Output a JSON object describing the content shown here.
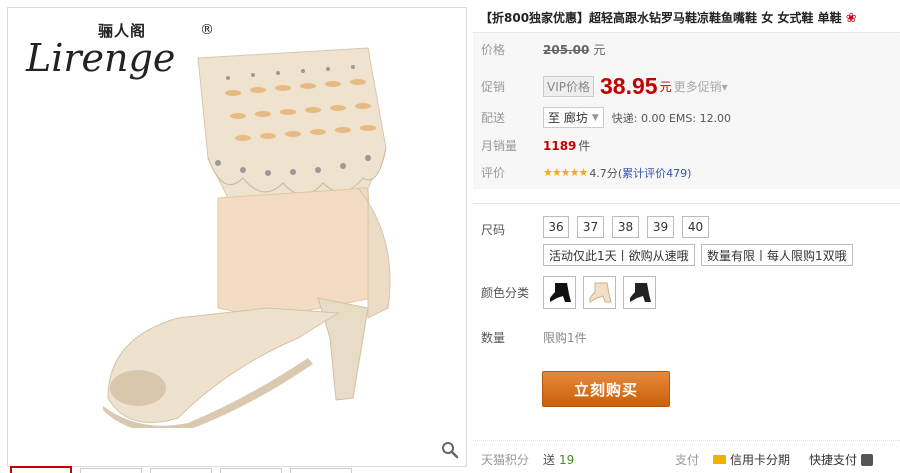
{
  "brand": {
    "cn": "骊人阁",
    "name": "Lirenge",
    "reg": "®"
  },
  "product": {
    "title": "【折800独家优惠】超轻高跟水钻罗马鞋凉鞋鱼嘴鞋 女 女式鞋 单鞋",
    "flower": "❀"
  },
  "price": {
    "label": "价格",
    "original": "205.00",
    "yuan": "元"
  },
  "promo": {
    "label": "促销",
    "vip": "VIP价格",
    "price": "38.95",
    "yuan": "元",
    "more": "更多促销▾"
  },
  "delivery": {
    "label": "配送",
    "region": "至 廊坊",
    "shipping": "快递: 0.00 EMS: 12.00"
  },
  "sales": {
    "label": "月销量",
    "count": "1189",
    "unit": "件"
  },
  "rating": {
    "label": "评价",
    "stars": "★★★★★",
    "score": "4.7分",
    "reviews": "(累计评价479)"
  },
  "options": {
    "size_label": "尺码",
    "sizes": [
      "36",
      "37",
      "38",
      "39",
      "40"
    ],
    "promo_tags": [
      "活动仅此1天丨欲购从速哦",
      "数量有限丨每人限购1双哦"
    ],
    "color_label": "颜色分类",
    "qty_label": "数量",
    "qty_note": "限购1件"
  },
  "buy_button": "立刻购买",
  "bottom": {
    "points_label": "天猫积分",
    "points_prefix": "送",
    "points_value": "19",
    "pay_label": "支付",
    "credit": "信用卡分期",
    "quick_pay": "快捷支付"
  },
  "colors": {
    "accent_red": "#c40000",
    "buy_orange": "#d96f1c",
    "link_blue": "#3355aa"
  }
}
